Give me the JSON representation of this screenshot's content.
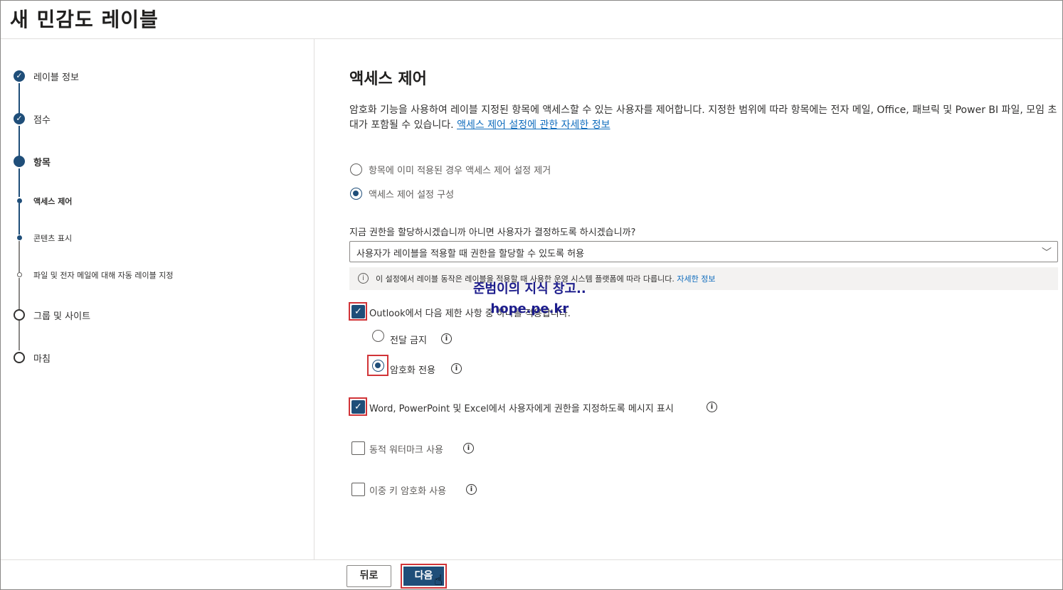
{
  "title": "새 민감도 레이블",
  "wizard": {
    "steps": [
      {
        "label": "레이블 정보",
        "state": "done"
      },
      {
        "label": "점수",
        "state": "done"
      },
      {
        "label": "항목",
        "state": "current"
      },
      {
        "label": "액세스 제어",
        "state": "sub-current"
      },
      {
        "label": "콘텐츠 표시",
        "state": "sub-upcoming"
      },
      {
        "label": "파일 및 전자 메일에 대해 자동 레이블 지정",
        "state": "sub-upcoming"
      },
      {
        "label": "그룹 및 사이트",
        "state": "todo"
      },
      {
        "label": "마침",
        "state": "todo"
      }
    ]
  },
  "main": {
    "section_title": "액세스 제어",
    "description": "암호화 기능을 사용하여 레이블 지정된 항목에 액세스할 수 있는 사용자를 제어합니다. 지정한 범위에 따라 항목에는 전자 메일, Office, 패브릭 및 Power BI 파일, 모임 초대가 포함될 수 있습니다.",
    "description_link": "액세스 제어 설정에 관한 자세한 정보",
    "radio_remove": "항목에 이미 적용된 경우 액세스 제어 설정 제거",
    "radio_configure": "액세스 제어 설정 구성",
    "question": "지금 권한을 할당하시겠습니까 아니면 사용자가 결정하도록 하시겠습니까?",
    "dropdown_value": "사용자가 레이블을 적용할 때 권한을 할당할 수 있도록 허용",
    "info_text": "이 설정에서 레이블 동작은 레이블을 적용할 때 사용한 운영 시스템 플랫폼에 따라 다릅니다.",
    "info_link": "자세한 정보",
    "outlook_checkbox": "Outlook에서 다음 제한 사항 중 하나를 적용합니다.",
    "do_not_forward": "전달 금지",
    "encrypt_only": "암호화 전용",
    "office_prompt": "Word, PowerPoint 및 Excel에서 사용자에게 권한을 지정하도록 메시지 표시",
    "dynamic_watermark": "동적 워터마크 사용",
    "double_key": "이중 키 암호화 사용",
    "watermark_line1": "준범이의 지식 창고..",
    "watermark_line2": "hope.pe.kr"
  },
  "footer": {
    "back": "뒤로",
    "next": "다음"
  },
  "colors": {
    "accent": "#1f4e79",
    "highlight": "#d13438",
    "link": "#0f6cbd"
  }
}
